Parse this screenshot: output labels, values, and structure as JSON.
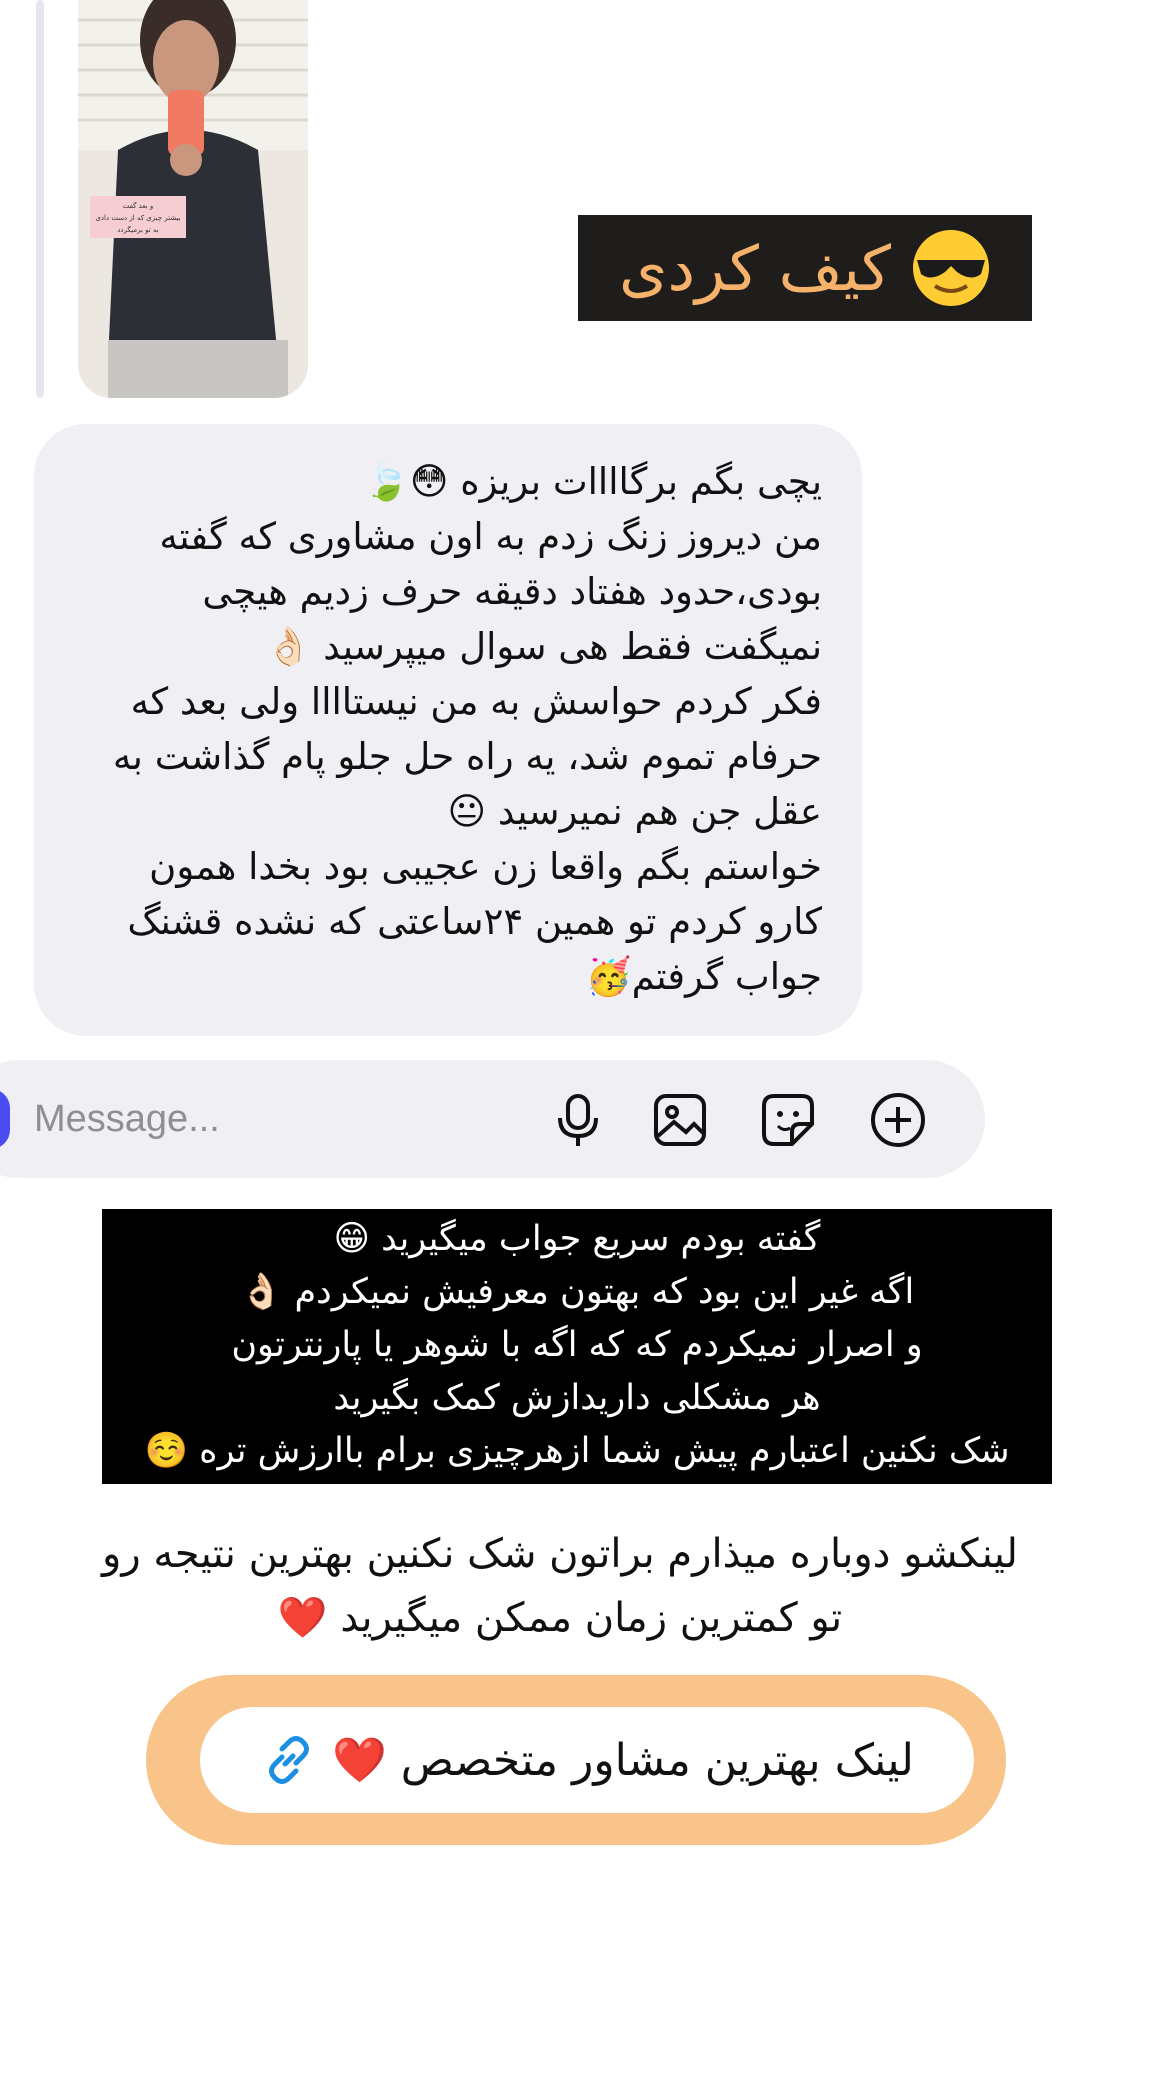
{
  "story_reply": {
    "thumbnail_icon": "woman-mirror-selfie-photo",
    "overlay_note": "و بعد گفت بیشتر چیزی که از دست دادی به تو برمیگردد"
  },
  "sticker": {
    "text": "کیف کردی",
    "emoji": "😎",
    "text_color": "#f6b26b",
    "background": "#1f1d1c"
  },
  "received_message": {
    "lines": [
      "یچی بگم برگاااات بریزه 😳🍃",
      "من دیروز زنگ زدم به اون مشاوری که گفته",
      "بودی،حدود هفتاد دقیقه حرف زدیم هیچی",
      "نمیگفت فقط هی سوال میپرسید 👌🏻",
      "فکر کردم حواسش به من نیستاااا ولی بعد که",
      "حرفام تموم شد، یه راه حل جلو پام گذاشت به",
      "عقل جن هم نمیرسید 😐",
      "خواستم بگم واقعا زن عجیبی بود بخدا همون",
      "کارو کردم تو همین ۲۴ساعتی که نشده قشنگ",
      "جواب گرفتم🥳"
    ],
    "bubble_color": "#efeff4"
  },
  "composer": {
    "placeholder": "Message...",
    "icons": [
      "microphone-icon",
      "gallery-icon",
      "sticker-icon",
      "plus-circle-icon"
    ]
  },
  "caption_block": {
    "lines": [
      "گفته بودم سریع جواب میگیرید 😁",
      "اگه غیر این بود که بهتون معرفیش نمیکردم 👌🏻",
      "و اصرار نمیکردم که که اگه با شوهر یا پارنترتون",
      "هر مشکلی داریدازش کمک بگیرید",
      "شک نکنین اعتبارم پیش شما ازهرچیزی برام باارزش تره ☺️"
    ]
  },
  "plain_message": {
    "lines": [
      "لینکشو دوباره میذارم براتون شک نکنین بهترین نتیجه رو",
      "تو کمترین زمان ممکن میگیرید ❤️"
    ]
  },
  "link_button": {
    "label": "لینک بهترین مشاور متخصص ❤️",
    "icon": "link-icon",
    "accent": "#f8c489",
    "icon_color": "#1a8fe3"
  }
}
